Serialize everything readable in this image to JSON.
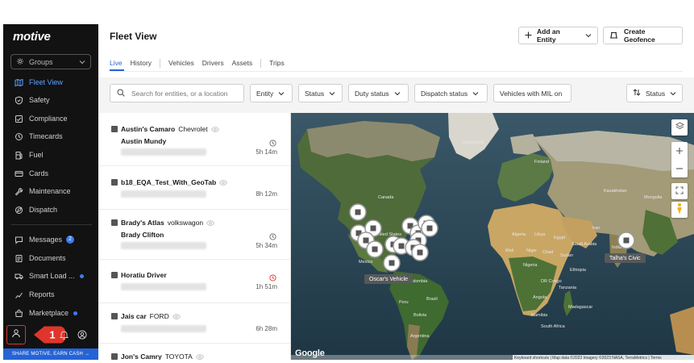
{
  "sidebar": {
    "logo": "motive",
    "groups_label": "Groups",
    "items": [
      {
        "label": "Fleet View",
        "icon": "map-icon",
        "active": true
      },
      {
        "label": "Safety",
        "icon": "shield-icon"
      },
      {
        "label": "Compliance",
        "icon": "compliance-icon"
      },
      {
        "label": "Timecards",
        "icon": "clock-icon"
      },
      {
        "label": "Fuel",
        "icon": "fuel-icon"
      },
      {
        "label": "Cards",
        "icon": "card-icon"
      },
      {
        "label": "Maintenance",
        "icon": "wrench-icon"
      },
      {
        "label": "Dispatch",
        "icon": "dispatch-icon"
      },
      {
        "label": "Messages",
        "icon": "message-icon",
        "badge": "2"
      },
      {
        "label": "Documents",
        "icon": "document-icon"
      },
      {
        "label": "Smart Load ...",
        "icon": "smart-load-icon",
        "dot": true
      },
      {
        "label": "Reports",
        "icon": "reports-icon"
      },
      {
        "label": "Marketplace",
        "icon": "marketplace-icon",
        "dot": true
      }
    ],
    "step_number": "1",
    "share_label": "SHARE MOTIVE, EARN CASH →"
  },
  "header": {
    "title": "Fleet View",
    "add_entity_label": "Add an Entity",
    "create_geofence_label": "Create Geofence"
  },
  "tabs": [
    {
      "label": "Live",
      "active": true
    },
    {
      "label": "History"
    },
    {
      "label": "Vehicles"
    },
    {
      "label": "Drivers"
    },
    {
      "label": "Assets"
    },
    {
      "label": "Trips"
    }
  ],
  "filters": {
    "search_placeholder": "Search for entities, or a location",
    "entity": "Entity",
    "status": "Status",
    "duty_status": "Duty status",
    "dispatch_status": "Dispatch status",
    "mil": "Vehicles with MIL on",
    "sort": "Status"
  },
  "vehicles": [
    {
      "name": "Austin's Camaro",
      "model": "Chevrolet",
      "driver": "Austin Mundy",
      "time": "5h 14m",
      "clock": "grey"
    },
    {
      "name": "b18_EQA_Test_With_GeoTab",
      "model": "",
      "driver": "",
      "time": "8h 12m",
      "clock": ""
    },
    {
      "name": "Brady's Atlas",
      "model": "volkswagon",
      "driver": "Brady Clifton",
      "time": "5h 34m",
      "clock": "grey"
    },
    {
      "name": "Horatiu Driver",
      "model": "",
      "driver": "",
      "time": "1h 51m",
      "clock": "red"
    },
    {
      "name": "Jais car",
      "model": "FORD",
      "driver": "",
      "time": "6h 28m",
      "clock": ""
    },
    {
      "name": "Jon's Camry",
      "model": "TOYOTA",
      "driver": "",
      "time": "",
      "clock": ""
    }
  ],
  "map": {
    "labels": {
      "oscar": "Oscar's Vehicle",
      "talha": "Talha's Civic"
    },
    "places": {
      "greenland": "Greenland",
      "canada": "Canada",
      "united_states": "United States",
      "mexico": "Mexico",
      "colombia": "Colombia",
      "peru": "Peru",
      "brazil": "Brazil",
      "bolivia": "Bolivia",
      "argentina": "Argentina",
      "finland": "Finland",
      "kazakhstan": "Kazakhstan",
      "mongolia": "Mongolia",
      "algeria": "Algeria",
      "libya": "Libya",
      "egypt": "Egypt",
      "saudi_arabia": "Saudi Arabia",
      "iran": "Iran",
      "niger": "Niger",
      "mali": "Mali",
      "chad": "Chad",
      "sudan": "Sudan",
      "nigeria": "Nigeria",
      "ethiopia": "Ethiopia",
      "dr_congo": "DR Congo",
      "tanzania": "Tanzania",
      "angola": "Angola",
      "namibia": "Namibia",
      "madagascar": "Madagascar",
      "south_africa": "South Africa",
      "india": "India"
    },
    "google": "Google",
    "attribution": "Keyboard shortcuts | Map data ©2023 Imagery ©2023 NASA, TerraMetrics | Terms"
  },
  "colors": {
    "accent": "#2563d6",
    "sidebar_bg": "#121212",
    "callout_red": "#e0352b",
    "alert_red": "#e0352b"
  }
}
